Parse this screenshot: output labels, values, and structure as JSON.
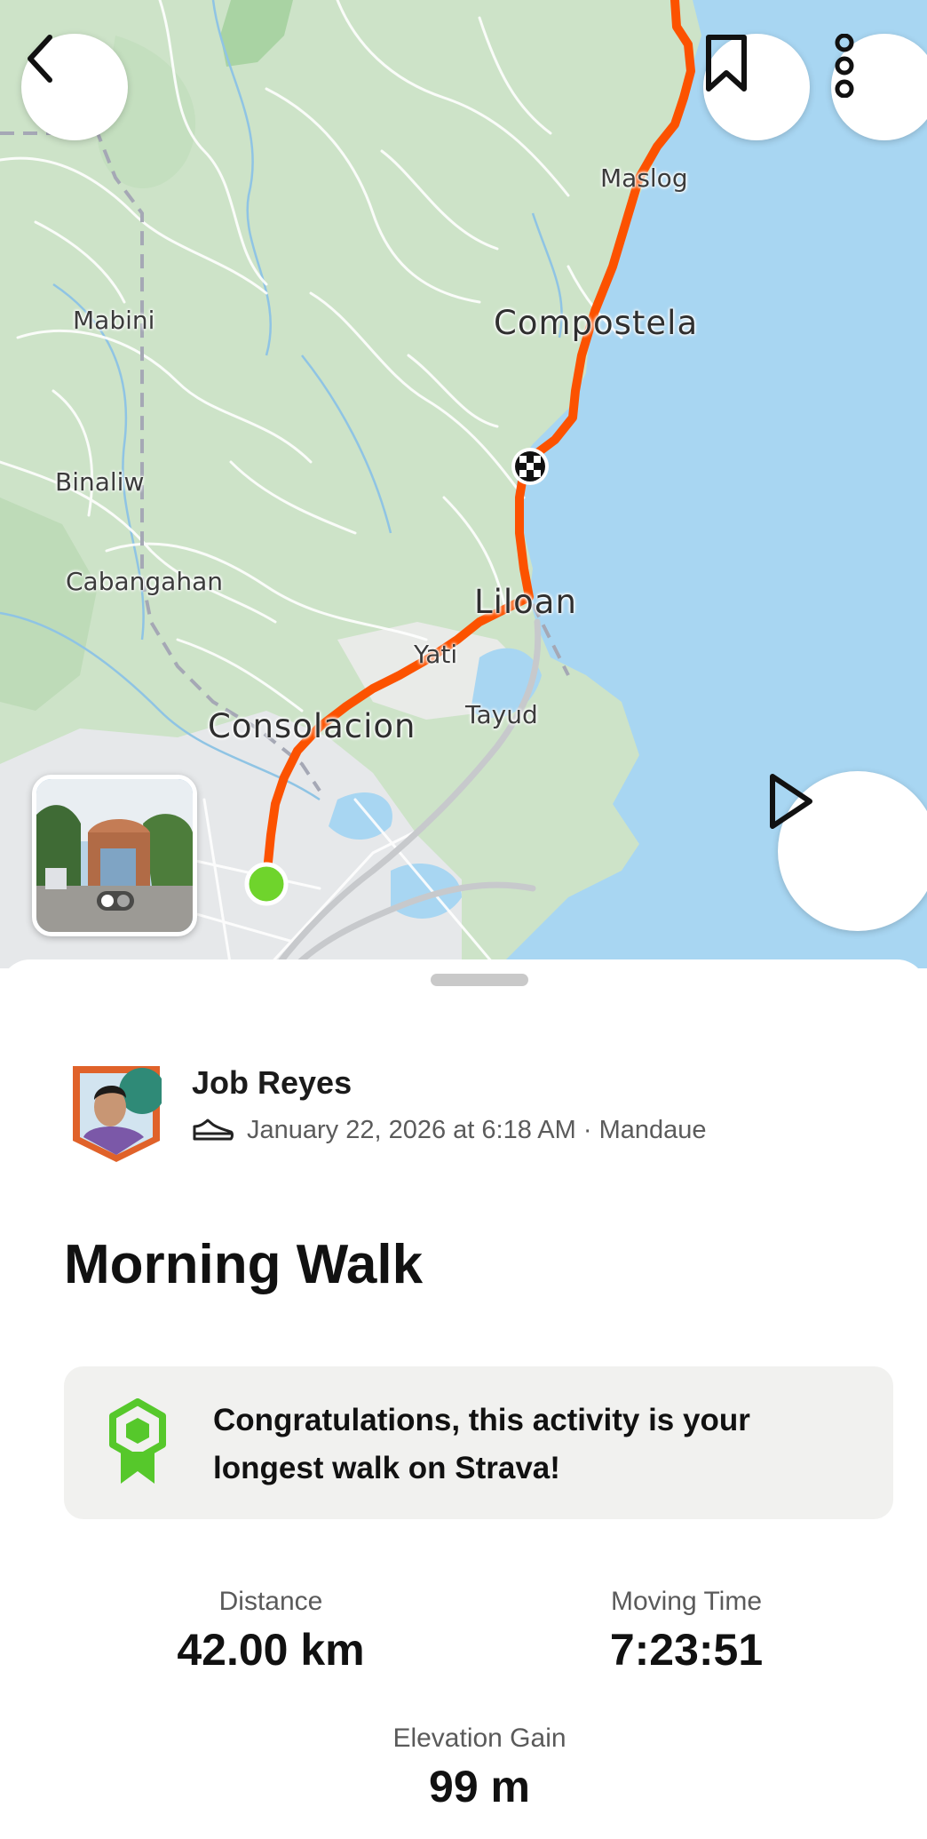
{
  "map": {
    "places": [
      {
        "name": "Maslog"
      },
      {
        "name": "Compostela"
      },
      {
        "name": "Mabini"
      },
      {
        "name": "Binaliw"
      },
      {
        "name": "Cabangahan"
      },
      {
        "name": "Liloan"
      },
      {
        "name": "Yati"
      },
      {
        "name": "Tayud"
      },
      {
        "name": "Consolacion"
      }
    ],
    "route_color": "#fc5200",
    "start_marker_color": "#6fd42c",
    "water_color": "#a8d6f2",
    "land_color": "#cde3c8"
  },
  "controls": {
    "back_icon": "chevron-left-icon",
    "bookmark_icon": "bookmark-icon",
    "more_icon": "more-vertical-icon",
    "play_icon": "play-icon"
  },
  "athlete": {
    "name": "Job Reyes",
    "activity_type_icon": "shoe-icon",
    "datetime_location": "January 22, 2026 at 6:18 AM · Mandaue"
  },
  "activity": {
    "title": "Morning Walk",
    "achievement": "Congratulations, this activity is your longest walk on Strava!",
    "achievement_color": "#56c82b"
  },
  "stats": {
    "distance": {
      "label": "Distance",
      "value": "42.00 km"
    },
    "moving_time": {
      "label": "Moving Time",
      "value": "7:23:51"
    },
    "elevation_gain": {
      "label": "Elevation Gain",
      "value": "99 m"
    }
  }
}
